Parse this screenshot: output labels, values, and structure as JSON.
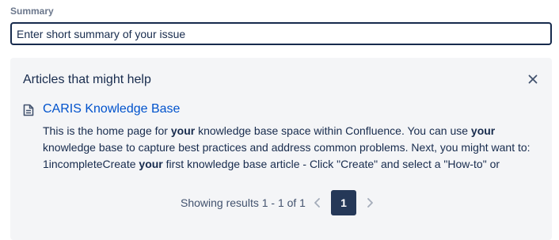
{
  "summary_field": {
    "label": "Summary",
    "value": "",
    "placeholder": "Enter short summary of your issue"
  },
  "articles_panel": {
    "title": "Articles that might help",
    "close_icon": "close-icon",
    "articles": [
      {
        "icon": "document-icon",
        "title": "CARIS Knowledge Base",
        "excerpt": {
          "t1": "This is the home page for ",
          "b1": "your",
          "t2": " knowledge base space within Confluence. You can use ",
          "b2": "your",
          "t3": " knowledge base to capture best practices and address common problems. Next, you might want to: 1incompleteCreate ",
          "b3": "your",
          "t4": " first knowledge base article - Click \"Create\" and select a \"How-to\" or"
        }
      }
    ],
    "pagination": {
      "summary_text": "Showing results 1 - 1 of 1",
      "current_page": "1",
      "prev_icon": "chevron-left-icon",
      "next_icon": "chevron-right-icon"
    }
  },
  "colors": {
    "text": "#172b4d",
    "link": "#0052cc",
    "panel_bg": "#f4f5f7",
    "active_page_bg": "#253858",
    "muted_label": "#6b778c",
    "disabled_icon": "#a5adba"
  }
}
